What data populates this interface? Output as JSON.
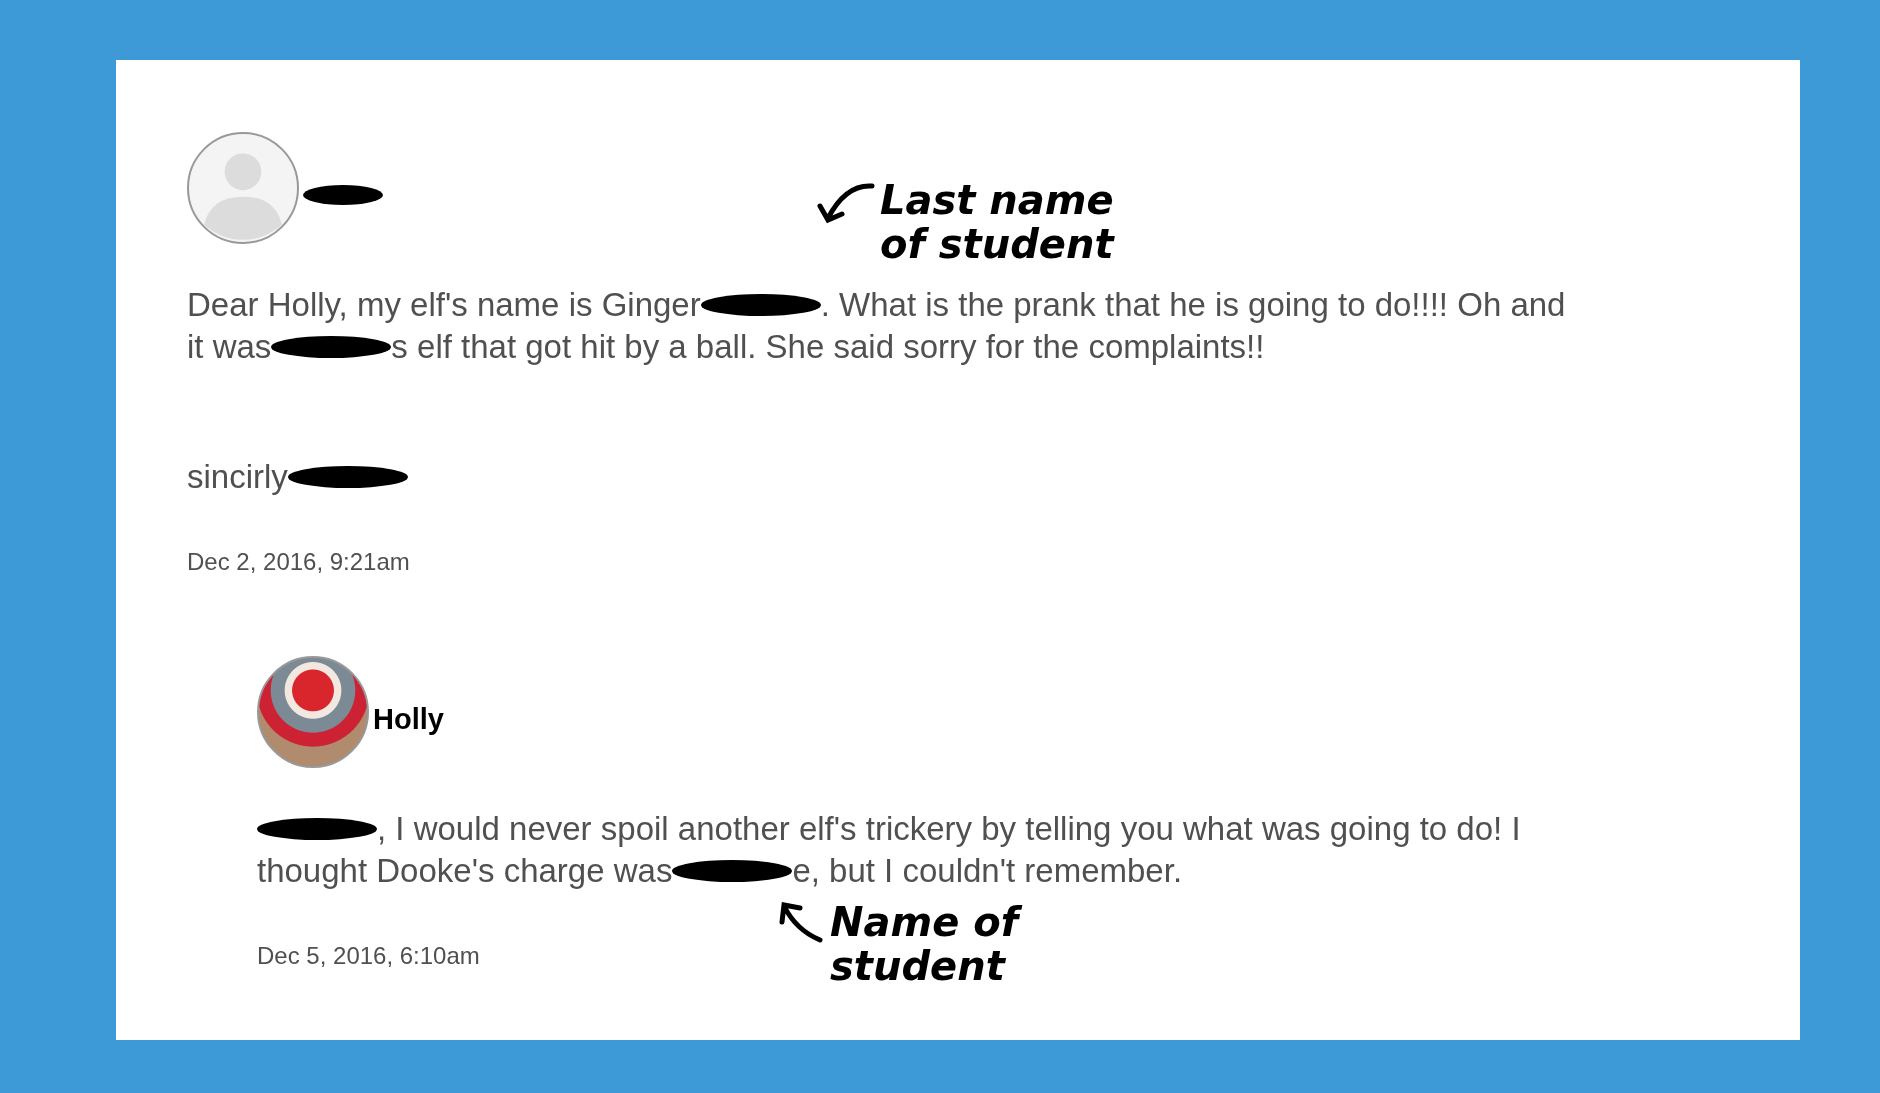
{
  "comment": {
    "author": [
      {
        "kind": "redacted"
      }
    ],
    "paragraphs": [
      [
        [
          {
            "kind": "text",
            "text": "Dear Holly, my elf's name is Ginger "
          },
          {
            "kind": "redacted"
          },
          {
            "kind": "text",
            "text": ". What is the prank that he is going to do!!!! Oh and"
          }
        ],
        [
          {
            "kind": "text",
            "text": "it was "
          },
          {
            "kind": "redacted"
          },
          {
            "kind": "text",
            "text": "s elf that got hit by a ball. She said sorry for the complaints!!"
          }
        ]
      ],
      [
        [
          {
            "kind": "text",
            "text": "sincirly "
          },
          {
            "kind": "redacted"
          }
        ]
      ]
    ],
    "date": "Dec 2, 2016, 9:21am"
  },
  "reply": {
    "author": [
      {
        "kind": "text",
        "text": "Holly"
      }
    ],
    "paragraphs": [
      [
        [
          {
            "kind": "redacted"
          },
          {
            "kind": "text",
            "text": ", I would never spoil another elf's trickery by telling you what was going to do! I"
          }
        ],
        [
          {
            "kind": "text",
            "text": "thought Dooke's charge was "
          },
          {
            "kind": "redacted"
          },
          {
            "kind": "text",
            "text": "e, but I couldn't remember."
          }
        ]
      ]
    ],
    "date": "Dec 5, 2016, 6:10am"
  },
  "annotations": [
    {
      "text": "Last name of student",
      "kind": "down"
    },
    {
      "text": "Name of student",
      "kind": "up"
    }
  ]
}
